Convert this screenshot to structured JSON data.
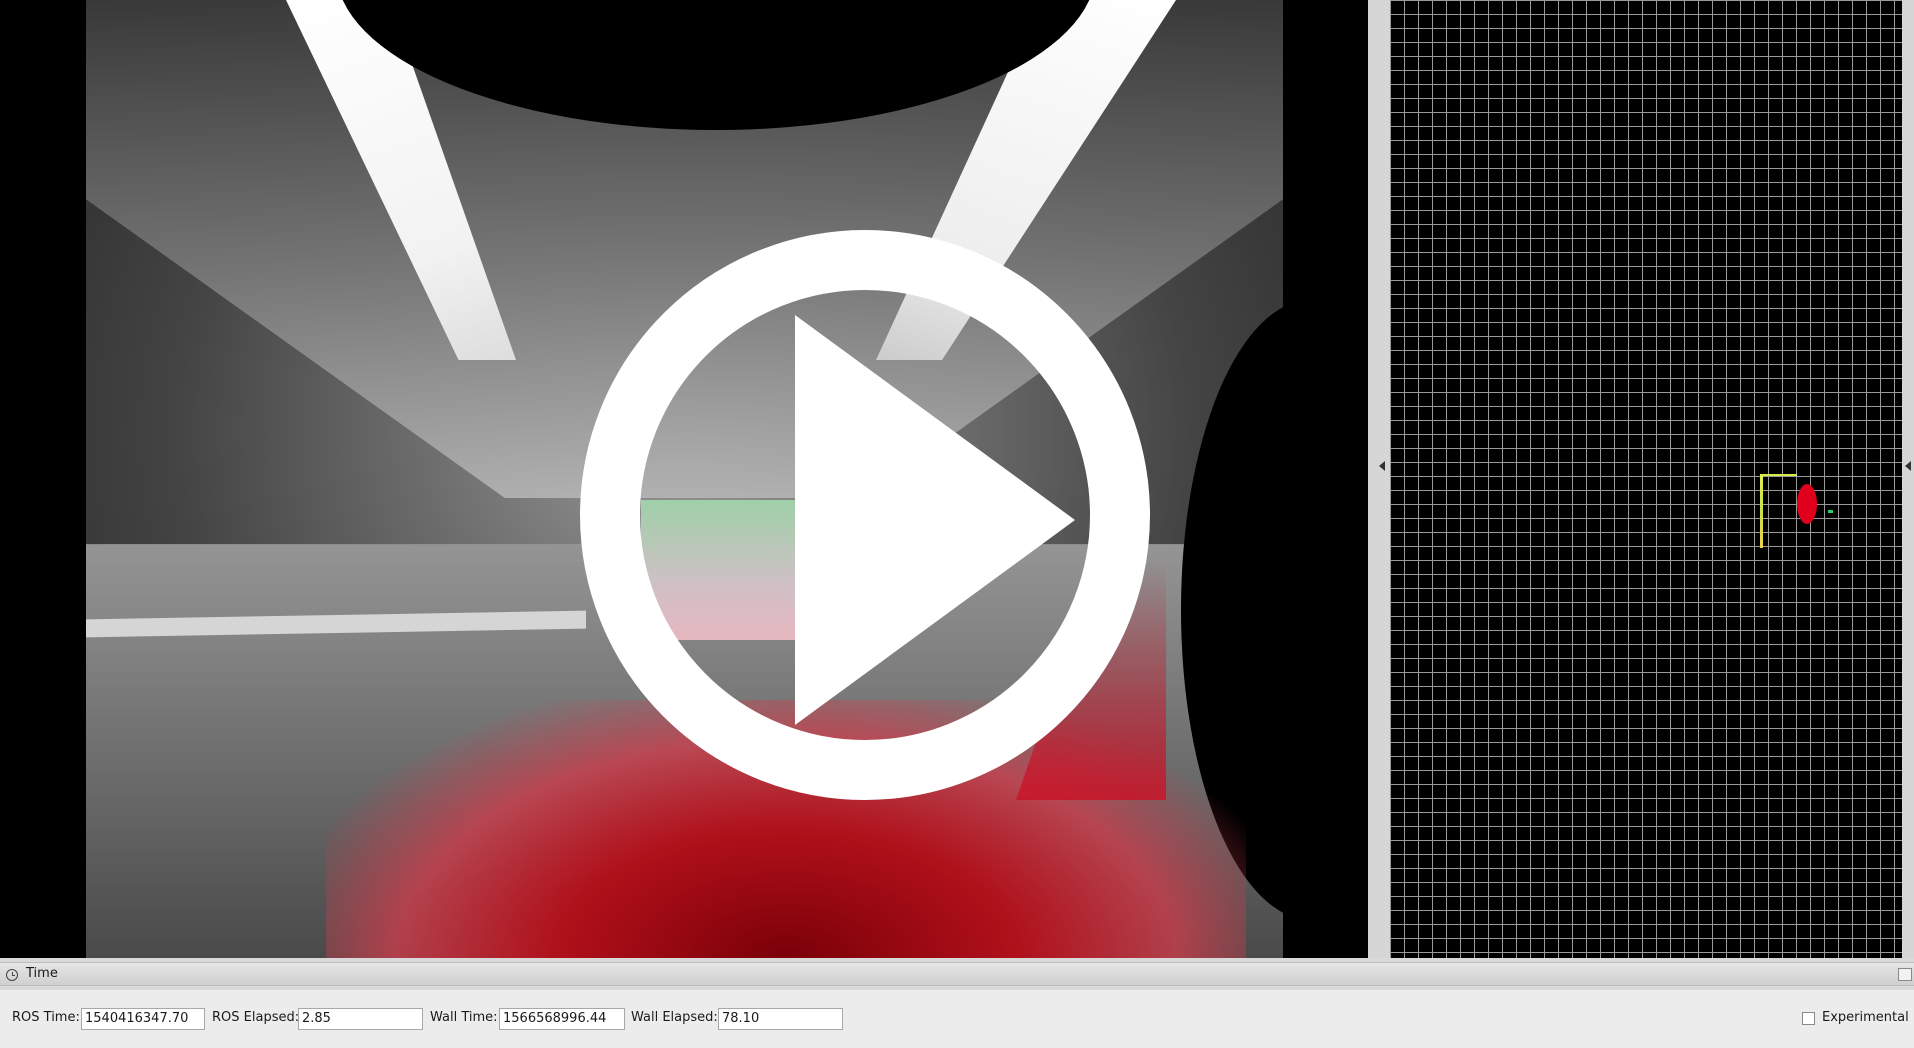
{
  "time_panel": {
    "title": "Time",
    "ros_time_label": "ROS Time:",
    "ros_time_value": "1540416347.70",
    "ros_elapsed_label": "ROS Elapsed:",
    "ros_elapsed_value": "2.85",
    "wall_time_label": "Wall Time:",
    "wall_time_value": "1566568996.44",
    "wall_elapsed_label": "Wall Elapsed:",
    "wall_elapsed_value": "78.10",
    "experimental_label": "Experimental",
    "experimental_checked": false
  },
  "icons": {
    "play": "play-icon",
    "clock": "clock-icon",
    "splitter_arrow": "chevron-left-icon"
  },
  "colors": {
    "point_cloud": "#b0101a",
    "grid_line": "#9a9a9a",
    "robot_marker": "#e0001c",
    "trace": "#e4f24c",
    "panel_bg": "#ececec"
  }
}
